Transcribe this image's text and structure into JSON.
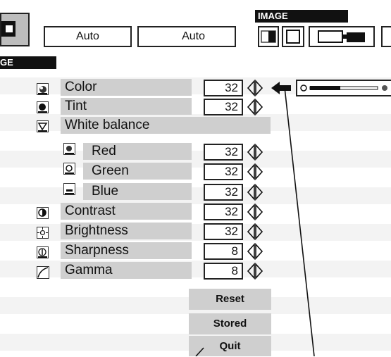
{
  "header": {
    "image_tab_label": "IMAGE",
    "mode_box_1": "Auto",
    "mode_box_2": "Auto",
    "left_tab_fragment": "GE"
  },
  "menu": {
    "items": [
      {
        "label": "Color",
        "value": "32",
        "icon": "color-icon"
      },
      {
        "label": "Tint",
        "value": "32",
        "icon": "tint-icon"
      },
      {
        "label": "White balance",
        "value": "",
        "icon": "white-balance-icon"
      },
      {
        "label": "Red",
        "value": "32",
        "icon": "red-icon"
      },
      {
        "label": "Green",
        "value": "32",
        "icon": "green-icon"
      },
      {
        "label": "Blue",
        "value": "32",
        "icon": "blue-icon"
      },
      {
        "label": "Contrast",
        "value": "32",
        "icon": "contrast-icon"
      },
      {
        "label": "Brightness",
        "value": "32",
        "icon": "brightness-icon"
      },
      {
        "label": "Sharpness",
        "value": "8",
        "icon": "sharpness-icon"
      },
      {
        "label": "Gamma",
        "value": "8",
        "icon": "gamma-icon"
      }
    ]
  },
  "buttons": {
    "reset": "Reset",
    "stored": "Stored",
    "quit": "Quit"
  },
  "slider": {
    "level_fraction": 0.45
  },
  "colors": {
    "bar_gray": "#cfcfcf",
    "black": "#111111"
  }
}
